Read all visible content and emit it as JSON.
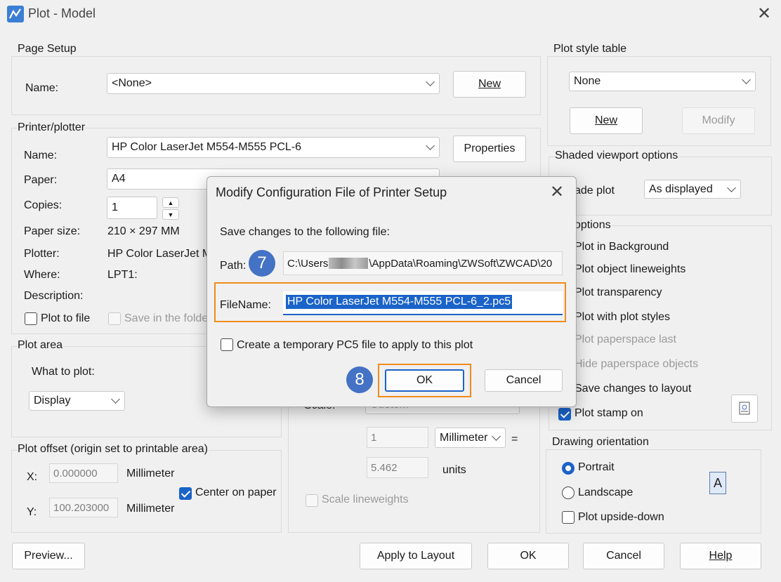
{
  "window": {
    "title": "Plot - Model"
  },
  "page_setup": {
    "title": "Page Setup",
    "name_label": "Name:",
    "name_value": "<None>",
    "new_button": "New"
  },
  "printer": {
    "title": "Printer/plotter",
    "name_label": "Name:",
    "name_value": "HP Color LaserJet M554-M555 PCL-6",
    "properties_button": "Properties",
    "paper_label": "Paper:",
    "paper_value": "A4",
    "copies_label": "Copies:",
    "copies_value": "1",
    "paper_size_label": "Paper size:",
    "paper_size_value": "210 × 297  MM",
    "plotter_label": "Plotter:",
    "plotter_value": "HP Color LaserJet M",
    "where_label": "Where:",
    "where_value": "LPT1:",
    "description_label": "Description:",
    "plot_to_file": "Plot to file",
    "save_in_folder": "Save in the folde"
  },
  "plot_area": {
    "title": "Plot area",
    "what_label": "What to plot:",
    "what_value": "Display"
  },
  "plot_offset": {
    "title": "Plot offset (origin set to printable area)",
    "x_label": "X:",
    "x_value": "0.000000",
    "x_unit": "Millimeter",
    "y_label": "Y:",
    "y_value": "100.203000",
    "y_unit": "Millimeter",
    "center_label": "Center on paper"
  },
  "scale": {
    "scale_label": "Scale:",
    "scale_value": "Custom",
    "value1": "1",
    "unit_value": "Millimeter",
    "equals": "=",
    "value2": "5.462",
    "units_label": "units",
    "scale_lineweights": "Scale lineweights"
  },
  "plot_style": {
    "title": "Plot style table",
    "value": "None",
    "new_button": "New",
    "modify_button": "Modify"
  },
  "shaded": {
    "title": "Shaded viewport options",
    "shade_label": "ade plot",
    "shade_value": "As displayed"
  },
  "options": {
    "title": "options",
    "items": [
      "Plot in Background",
      "Plot object lineweights",
      "Plot transparency",
      "Plot with plot styles",
      "Plot paperspace last",
      "Hide paperspace objects",
      "Save changes to layout",
      "Plot stamp on"
    ]
  },
  "orientation": {
    "title": "Drawing orientation",
    "portrait": "Portrait",
    "landscape": "Landscape",
    "upside_down": "Plot upside-down",
    "icon_letter": "A"
  },
  "footer": {
    "preview": "Preview...",
    "apply": "Apply to Layout",
    "ok": "OK",
    "cancel": "Cancel",
    "help": "Help"
  },
  "modal": {
    "title": "Modify Configuration File of Printer Setup",
    "save_text": "Save changes to the following file:",
    "path_label": "Path:",
    "path_value_start": "C:\\Users",
    "path_value_end": "\\AppData\\Roaming\\ZWSoft\\ZWCAD\\20",
    "filename_label": "FileName:",
    "filename_value": "HP Color LaserJet M554-M555 PCL-6_2.pc5",
    "temp_label": "Create a temporary PC5 file to apply to this plot",
    "ok": "OK",
    "cancel": "Cancel",
    "badge_path": "7",
    "badge_ok": "8"
  }
}
